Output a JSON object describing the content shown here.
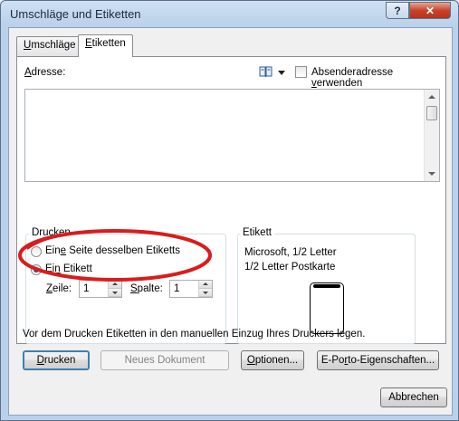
{
  "window": {
    "title": "Umschläge und Etiketten",
    "help": "?",
    "close": "✕"
  },
  "tabs": [
    {
      "pre": "",
      "u": "U",
      "post": "mschläge"
    },
    {
      "pre": "",
      "u": "E",
      "post": "tiketten"
    }
  ],
  "address": {
    "label_u": "A",
    "label_rest": "dresse:",
    "book_icon": "address-book-icon",
    "sender_pre": "Absenderadresse ",
    "sender_u": "v",
    "sender_post": "erwenden",
    "value": ""
  },
  "print_group": {
    "title": "Drucken",
    "opt1_pre": "Ein",
    "opt1_u": "e",
    "opt1_post": " Seite desselben Etiketts",
    "opt2_pre": "Ei",
    "opt2_u": "n",
    "opt2_post": " Etikett",
    "row_label_u": "Z",
    "row_label_rest": "eile:",
    "row_value": "1",
    "col_label_u": "S",
    "col_label_rest": "palte:",
    "col_value": "1"
  },
  "label_group": {
    "title": "Etikett",
    "line1": "Microsoft, 1/2 Letter",
    "line2": "1/2 Letter Postkarte"
  },
  "hint": "Vor dem Drucken Etiketten in den manuellen Einzug Ihres Druckers legen.",
  "buttons": {
    "print_u": "D",
    "print_rest": "rucken",
    "new_doc": "Neues Dokument",
    "options_u": "O",
    "options_rest": "ptionen...",
    "eporto_pre": "E-Po",
    "eporto_u": "r",
    "eporto_post": "to-Eigenschaften...",
    "cancel": "Abbrechen"
  },
  "colors": {
    "annotation": "#d91c1c"
  }
}
